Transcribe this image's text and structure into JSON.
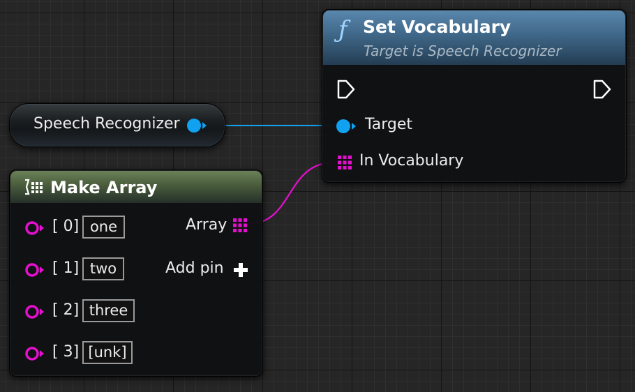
{
  "set_vocabulary": {
    "title": "Set Vocabulary",
    "subtitle": "Target is Speech Recognizer",
    "icon": "function-icon",
    "pins": {
      "target": "Target",
      "in_vocabulary": "In Vocabulary"
    }
  },
  "speech_recognizer": {
    "label": "Speech Recognizer"
  },
  "make_array": {
    "title": "Make Array",
    "output_label": "Array",
    "add_pin_label": "Add pin",
    "items": [
      {
        "index": "[ 0]",
        "value": "one"
      },
      {
        "index": "[ 1]",
        "value": "two"
      },
      {
        "index": "[ 2]",
        "value": "three"
      },
      {
        "index": "[ 3]",
        "value": "[unk]"
      }
    ]
  },
  "colors": {
    "object_pin": "#10a2f0",
    "string_pin": "#e60fd0",
    "function_header": "#3f6788",
    "make_array_header": "#495c3c",
    "exec_pin": "#ffffff"
  }
}
